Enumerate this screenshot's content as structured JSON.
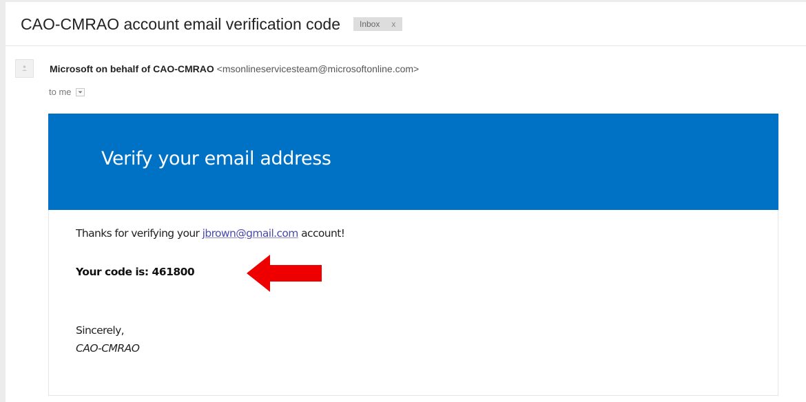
{
  "email": {
    "subject": "CAO-CMRAO account email verification code",
    "label": {
      "text": "Inbox",
      "remove_glyph": "x"
    },
    "sender": {
      "name": "Microsoft on behalf of CAO-CMRAO",
      "address": "<msonlineservicesteam@microsoftonline.com>",
      "avatar_icon": "person-icon"
    },
    "recipient_line": "to me",
    "details_icon": "chevron-down-icon"
  },
  "message": {
    "banner_title": "Verify your email address",
    "thanks_prefix": "Thanks for verifying your ",
    "email_link": "jbrown@gmail.com",
    "thanks_suffix": " account!",
    "code_label": "Your code is: ",
    "code_value": "461800",
    "signoff": "Sincerely,",
    "signature": "CAO-CMRAO"
  },
  "annotation": {
    "arrow_icon": "left-arrow-icon",
    "arrow_color": "#ee0000"
  },
  "colors": {
    "banner_blue": "#0072c6",
    "link_color": "#4a4aa8",
    "page_background": "#ececec"
  }
}
